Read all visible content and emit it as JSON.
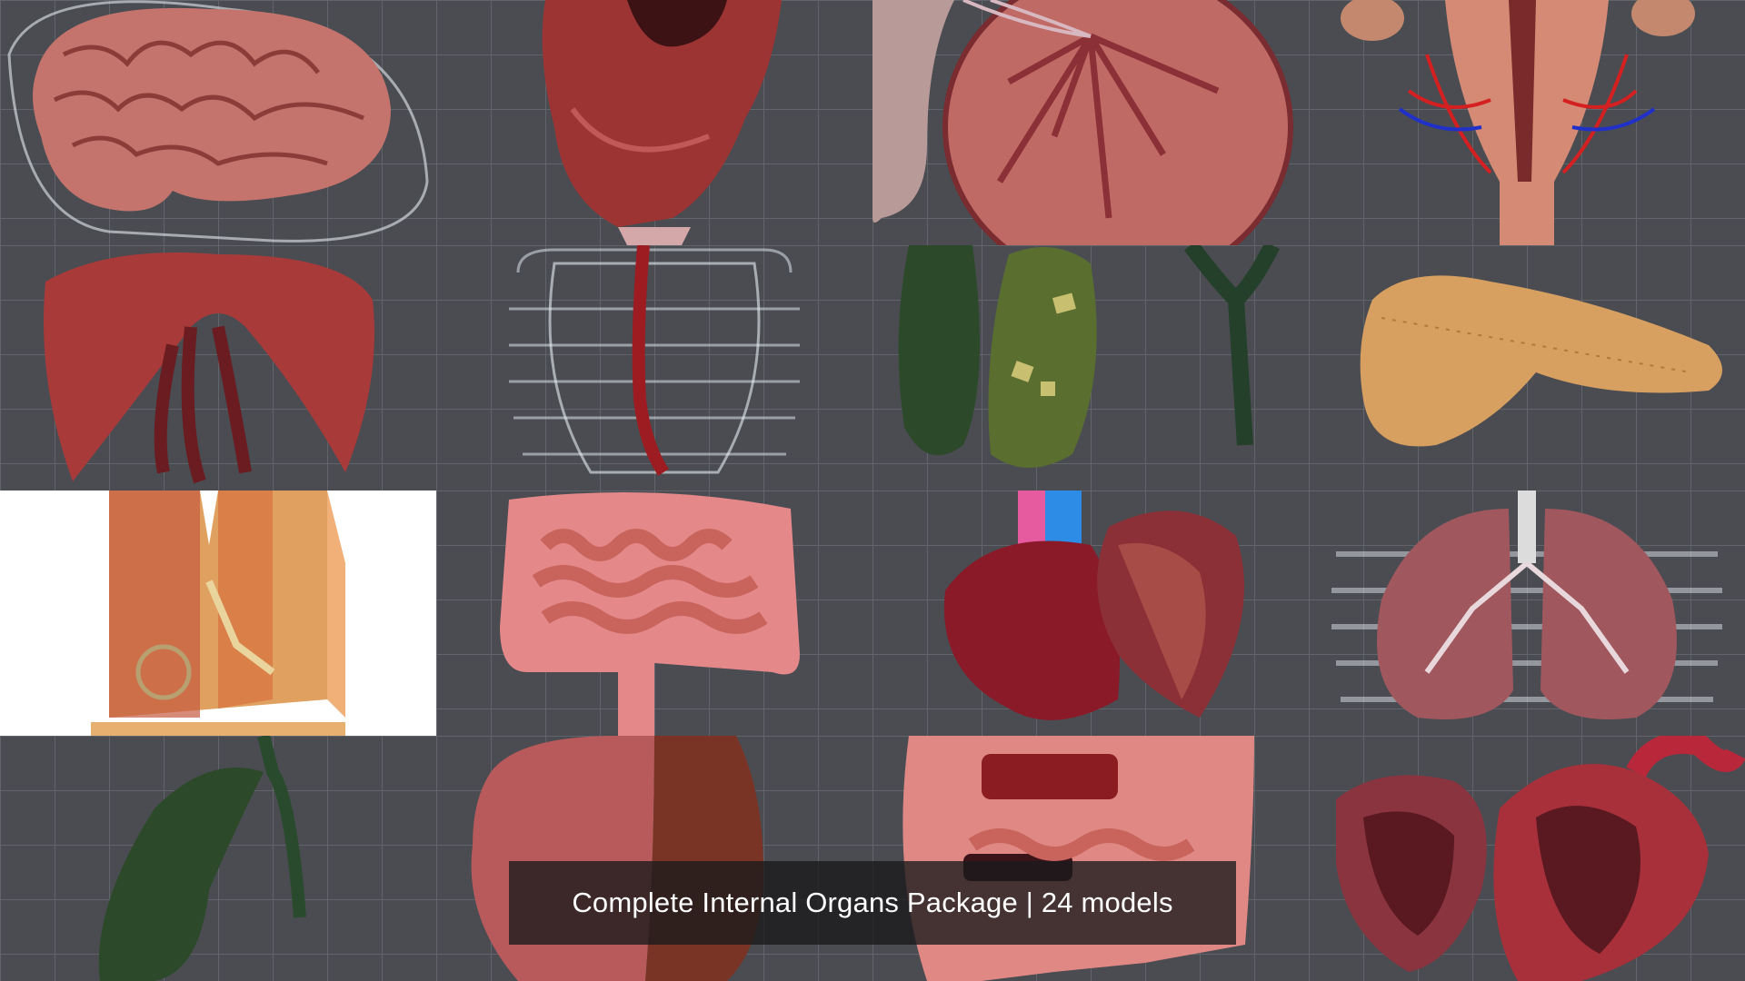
{
  "caption": {
    "text": "Complete Internal Organs Package | 24 models"
  },
  "tiles": [
    {
      "row": 1,
      "col": 1,
      "subject": "brain"
    },
    {
      "row": 1,
      "col": 2,
      "subject": "larynx-section"
    },
    {
      "row": 1,
      "col": 3,
      "subject": "testis-cross-section"
    },
    {
      "row": 1,
      "col": 4,
      "subject": "uterus"
    },
    {
      "row": 2,
      "col": 1,
      "subject": "diaphragm"
    },
    {
      "row": 2,
      "col": 2,
      "subject": "esophagus-in-ribcage"
    },
    {
      "row": 2,
      "col": 3,
      "subject": "gallbladder-with-stones"
    },
    {
      "row": 2,
      "col": 4,
      "subject": "pancreas"
    },
    {
      "row": 3,
      "col": 1,
      "subject": "skin-cross-section"
    },
    {
      "row": 3,
      "col": 2,
      "subject": "intestines"
    },
    {
      "row": 3,
      "col": 3,
      "subject": "liver-section"
    },
    {
      "row": 3,
      "col": 4,
      "subject": "lungs"
    },
    {
      "row": 4,
      "col": 1,
      "subject": "gallbladder"
    },
    {
      "row": 4,
      "col": 2,
      "subject": "kidney-section"
    },
    {
      "row": 4,
      "col": 3,
      "subject": "intestines-section"
    },
    {
      "row": 4,
      "col": 4,
      "subject": "heart-section"
    }
  ],
  "colors": {
    "floor": "#4a4c52",
    "tissue_red": "#a8383c",
    "brain_pink": "#c87870",
    "gallbladder_green": "#3c5a2c",
    "pancreas_tan": "#d8a060",
    "caption_bg": "#19191b"
  }
}
